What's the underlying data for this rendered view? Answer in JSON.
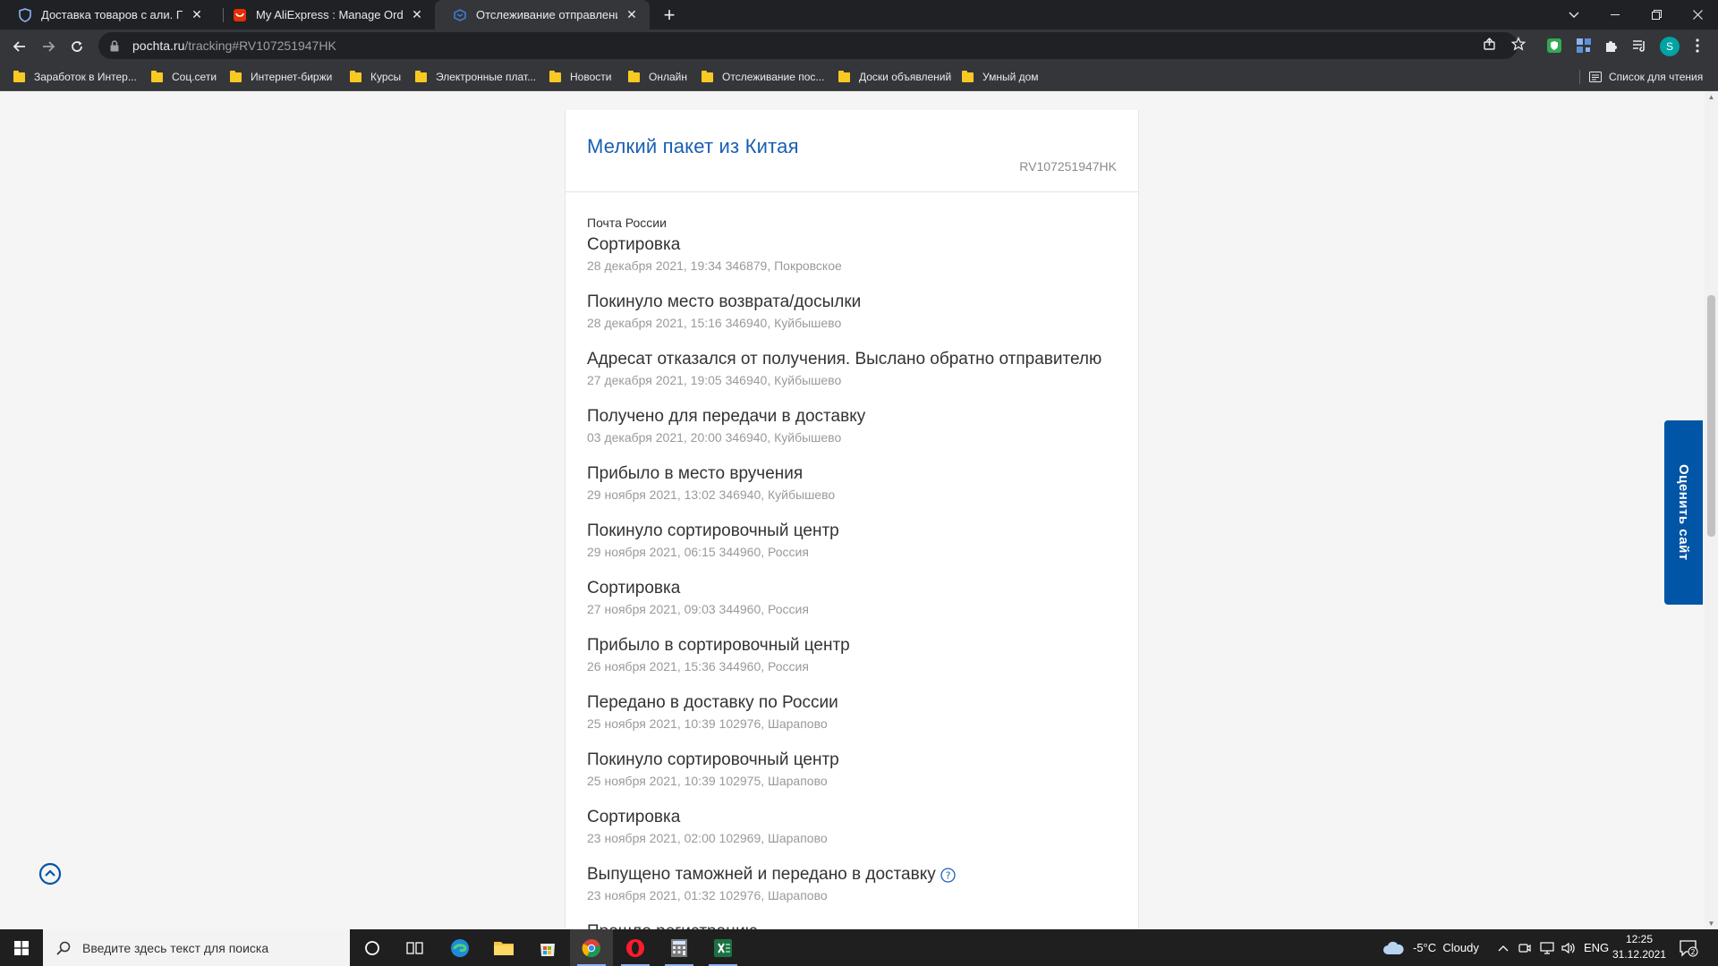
{
  "browser": {
    "tabs": [
      {
        "title": "Доставка товаров с али. Пробл",
        "active": false
      },
      {
        "title": "My AliExpress : Manage Orders",
        "active": false
      },
      {
        "title": "Отслеживание отправлений —",
        "active": true
      }
    ],
    "url_host": "pochta.ru",
    "url_path": "/tracking#RV107251947HK",
    "profile_letter": "S",
    "bookmarks": [
      "Заработок в Интер...",
      "Соц.сети",
      "Интернет-биржи",
      "Курсы",
      "Электронные плат...",
      "Новости",
      "Онлайн",
      "Отслеживание пос...",
      "Доски объявлений",
      "Умный дом"
    ],
    "reading_list": "Список для чтения"
  },
  "tracking": {
    "title": "Мелкий пакет из Китая",
    "number": "RV107251947HK",
    "carrier": "Почта России",
    "events": [
      {
        "title": "Сортировка",
        "meta": "28 декабря 2021, 19:34 346879, Покровское",
        "help": false
      },
      {
        "title": "Покинуло место возврата/досылки",
        "meta": "28 декабря 2021, 15:16 346940, Куйбышево",
        "help": false
      },
      {
        "title": "Адресат отказался от получения. Выслано обратно отправителю",
        "meta": "27 декабря 2021, 19:05 346940, Куйбышево",
        "help": false
      },
      {
        "title": "Получено для передачи в доставку",
        "meta": "03 декабря 2021, 20:00 346940, Куйбышево",
        "help": false
      },
      {
        "title": "Прибыло в место вручения",
        "meta": "29 ноября 2021, 13:02 346940, Куйбышево",
        "help": false
      },
      {
        "title": "Покинуло сортировочный центр",
        "meta": "29 ноября 2021, 06:15 344960, Россия",
        "help": false
      },
      {
        "title": "Сортировка",
        "meta": "27 ноября 2021, 09:03 344960, Россия",
        "help": false
      },
      {
        "title": "Прибыло в сортировочный центр",
        "meta": "26 ноября 2021, 15:36 344960, Россия",
        "help": false
      },
      {
        "title": "Передано в доставку по России",
        "meta": "25 ноября 2021, 10:39 102976, Шарапово",
        "help": false
      },
      {
        "title": "Покинуло сортировочный центр",
        "meta": "25 ноября 2021, 10:39 102975, Шарапово",
        "help": false
      },
      {
        "title": "Сортировка",
        "meta": "23 ноября 2021, 02:00 102969, Шарапово",
        "help": false
      },
      {
        "title": "Выпущено таможней и передано в доставку",
        "meta": "23 ноября 2021, 01:32 102976, Шарапово",
        "help": true
      },
      {
        "title": "Прошло регистрацию",
        "meta": "",
        "help": false
      }
    ]
  },
  "rate_site": "Оценить сайт",
  "taskbar": {
    "search_placeholder": "Введите здесь текст для поиска",
    "weather": "-5°C  Cloudy",
    "lang": "ENG",
    "time": "12:25",
    "date": "31.12.2021",
    "notifications": "2"
  },
  "colors": {
    "accent": "#1a5fb4",
    "rate_tab": "#0055a6"
  }
}
